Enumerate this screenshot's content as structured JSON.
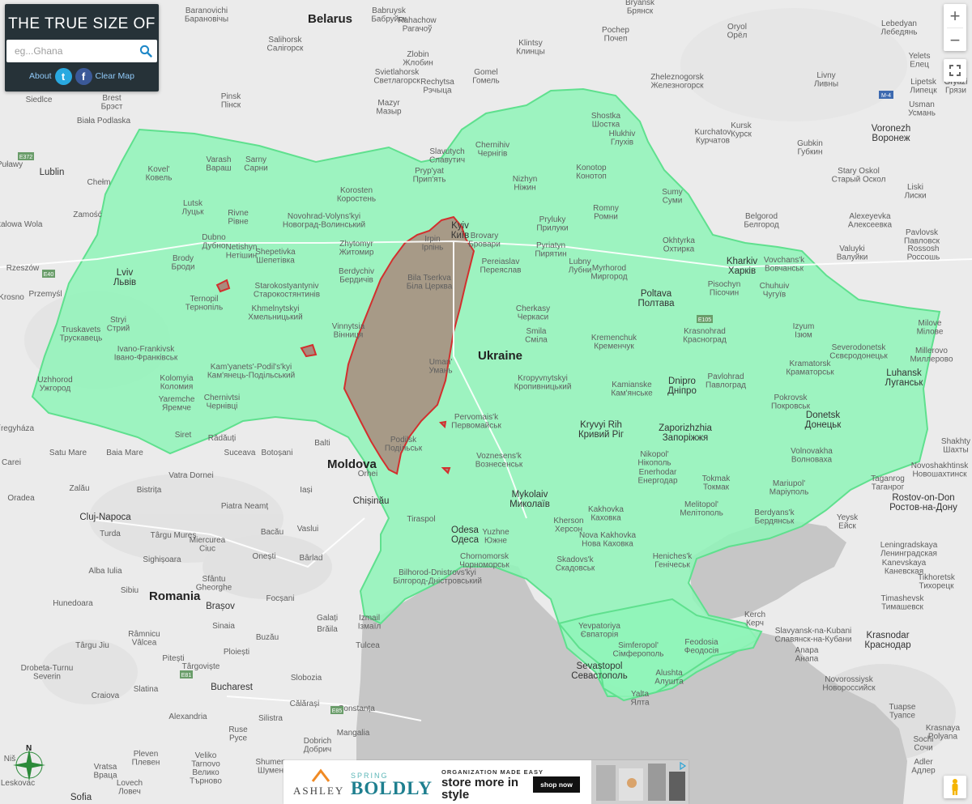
{
  "app": {
    "title": "THE TRUE SIZE OF ...",
    "search_placeholder": "eg...Ghana",
    "about_label": "About",
    "twitter_label": "t",
    "facebook_label": "f",
    "clear_map_label": "Clear Map"
  },
  "controls": {
    "zoom_in": "+",
    "zoom_out": "−"
  },
  "compass": {
    "north_label": "N"
  },
  "map": {
    "countries": {
      "belarus": "Belarus",
      "ukraine": "Ukraine",
      "moldova": "Moldova",
      "romania": "Romania"
    },
    "places": {
      "baranovichi": "Baranovichi\nБарановічы",
      "babruysk": "Babruysk\nБабруйск",
      "salihorsk": "Salihorsk\nСалігорск",
      "rachu": "Rahachow\nРагачоў",
      "pochep": "Pochep\nПочеп",
      "bryansk": "Bryansk\nБрянск",
      "oryol": "Oryol\nОрёл",
      "lebedyan": "Lebedyan\nЛебедянь",
      "yelets": "Yelets\nЕлец",
      "zlobin": "Zlobin\nЖлобин",
      "klintsy": "Klintsy\nКлинцы",
      "gomel": "Gomel\nГомель",
      "svietlahorsk": "Svietlahorsk\nСветлагорск",
      "rechytsa": "Rechytsa\nРэчыца",
      "livny": "Livny\nЛивны",
      "lipetsk": "Lipetsk\nЛипецк",
      "zheleznogorsk": "Zheleznogorsk\nЖелезногорск",
      "gryazi": "Gryazi\nГрязи",
      "pinsk": "Pinsk\nПінск",
      "mazyr": "Mazyr\nМазыр",
      "brest": "Brest\nБрэст",
      "siedlce": "Siedlce",
      "biala": "Biała Podlaska",
      "shostka": "Shostka\nШостка",
      "chernihiv": "Chernihiv\nЧернігів",
      "hlukhiv": "Hlukhiv\nГлухів",
      "kursk": "Kursk\nКурск",
      "kurchatov": "Kurchatov\nКурчатов",
      "usman": "Usman\nУсмань",
      "voronezh": "Voronezh\nВоронеж",
      "lublin": "Lublin",
      "chelm": "Chełm",
      "pulawy": "Puławy",
      "kovel": "Kovel'\nКовель",
      "varash": "Varash\nВараш",
      "sarny": "Sarny\nСарни",
      "slavutych": "Slavutych\nСлавутич",
      "prypyat": "Pryp'yat\nПрип'ять",
      "korosten": "Korosten\nКоростень",
      "nizhyn": "Nizhyn\nНіжин",
      "konotop": "Konotop\nКонотоп",
      "gubkin": "Gubkin\nГубкин",
      "stary_oskol": "Stary Oskol\nСтарый Оскол",
      "liski": "Liski\nЛиски",
      "sumy": "Sumy\nСуми",
      "romny": "Romny\nРомни",
      "lutsk": "Lutsk\nЛуцьк",
      "zamosc": "Zamość",
      "rivne": "Rivne\nРівне",
      "novohrad": "Novohrad-Volyns'kyi\nНовоград-Волинський",
      "kyiv": "Kyiv\nКиїв",
      "irpin": "Irpin\nІрпінь",
      "brovary": "Brovary\nБровари",
      "pryluky": "Pryluky\nПрилуки",
      "belgorod": "Belgorod\nБелгород",
      "alexeyevka": "Alexeyevka\nАлексеевка",
      "stalowa": "Stalowa Wola",
      "dubno": "Dubno\nДубно",
      "netishyn": "Netishyn\nНетішин",
      "shepetivka": "Shepetivka\nШепетівка",
      "zhytomyr": "Zhytomyr\nЖитомир",
      "pyriatyn": "Pyriatyn\nПирятин",
      "okhtyrka": "Okhtyrka\nОхтирка",
      "pavlovsk": "Pavlovsk\nПавловск",
      "rzeszow": "Rzeszów",
      "brody": "Brody\nБроди",
      "berdychiv": "Berdychiv\nБердичів",
      "pereiaslav": "Pereiaslav\nПереяслав",
      "lubny": "Lubny\nЛубни",
      "myrhorod": "Myrhorod\nМиргород",
      "kharkiv": "Kharkiv\nХарків",
      "vovchansk": "Vovchans'k\nВовчанськ",
      "valuyki": "Valuyki\nВалуйки",
      "rossosh": "Rossosh\nРоссошь",
      "krosno": "Krosno",
      "przemysl": "Przemyśl",
      "lviv": "Lviv\nЛьвів",
      "starokostiantyniv": "Starokostyantyniv\nСтарокостянтинів",
      "bila_tserkva": "Bila Tserkva\nБіла Церква",
      "poltava": "Poltava\nПолтава",
      "pisochyn": "Pisochyn\nПісочин",
      "chuhuiv": "Chuhuiv\nЧугуїв",
      "ternopil": "Ternopil\nТернопіль",
      "khmelnytskyi": "Khmelnytskyi\nХмельницький",
      "cherkasy": "Cherkasy\nЧеркаси",
      "stryi": "Stryi\nСтрий",
      "truskavets": "Truskavets\nТрускавець",
      "vinnytsia": "Vinnytsia\nВінниця",
      "smila": "Smila\nСміла",
      "kremenchuk": "Kremenchuk\nКременчук",
      "krasnohrad": "Krasnohrad\nКрасноград",
      "izyum": "Izyum\nІзюм",
      "millerovo": "Millerovo\nМиллерово",
      "milove": "Milove\nМілове",
      "ivano": "Ivano-Frankivsk\nІвано-Франківськ",
      "uman": "Uman'\nУмань",
      "severodonetsk": "Severodonetsk\nСєвєродонецьк",
      "kramatorsk": "Kramatorsk\nКраматорськ",
      "uzhhorod": "Uzhhorod\nУжгород",
      "kamianets": "Kam'yanets'-Podil's'kyi\nКам'янець-Подільський",
      "kolomyia": "Kolomyia\nКоломия",
      "kropyvnytskyi": "Kropyvnytskyi\nКропивницький",
      "dnipro": "Dnipro\nДніпро",
      "kamianske": "Kamianske\nКам'янське",
      "pavlohrad": "Pavlohrad\nПавлоград",
      "luhansk": "Luhansk\nЛуганськ",
      "yaremche": "Yaremche\nЯремче",
      "chernivtsi": "Chernivtsi\nЧернівці",
      "pervomaisk": "Pervomais'k\nПервомайськ",
      "pokrovsk": "Pokrovsk\nПокровськ",
      "donetsk": "Donetsk\nДонецьк",
      "nyiregyhaza": "Nyíregyháza",
      "siret": "Siret",
      "radauti": "Rădăuți",
      "balti": "Balti",
      "podilsk": "Podilsk\nПодільськ",
      "kryvyi": "Kryvyi Rih\nКривий Ріг",
      "zaporizhzhia": "Zaporizhzhia\nЗапоріжжя",
      "shakhty": "Shakhty\nШахты",
      "satu_mare": "Satu Mare",
      "baia_mare": "Baia Mare",
      "suceava": "Suceava",
      "botosani": "Botoșani",
      "orhei": "Orhei",
      "voznesensk": "Voznesens'k\nВознесенськ",
      "nikopol": "Nikopol'\nНікополь",
      "enerhodar": "Enerhodar\nЕнергодар",
      "volnovakha": "Volnovakha\nВолноваха",
      "novoshakhtinsk": "Novoshakhtinsk\nНовошахтинск",
      "carei": "Carei",
      "vatra_dornei": "Vatra Dornei",
      "tokmak": "Tokmak\nТокмак",
      "mariupol": "Mariupol'\nМаріуполь",
      "taganrog": "Taganrog\nТаганрог",
      "rostov": "Rostov-on-Don\nРостов-на-Дону",
      "oradea": "Oradea",
      "zalau": "Zalău",
      "bistrita": "Bistrița",
      "iasi": "Iași",
      "chisinau": "Chișinău",
      "mykolaiv": "Mykolaiv\nМиколаїв",
      "melitopol": "Melitopol'\nМелітополь",
      "berdyansk": "Berdyans'k\nБердянськ",
      "piatra": "Piatra Neamț",
      "tiraspol": "Tiraspol",
      "kherson": "Kherson\nХерсон",
      "kakhovka": "Kakhovka\nКаховка",
      "yeysk": "Yeysk\nЕйск",
      "cluj": "Cluj-Napoca",
      "targu_mures": "Târgu Mureș",
      "bacau": "Bacău",
      "vaslui": "Vaslui",
      "odesa": "Odesa\nОдеса",
      "yuzhne": "Yuzhne\nЮжне",
      "nova_kakhovka": "Nova Kakhovka\nНова Каховка",
      "turda": "Turda",
      "miercurea": "Miercurea\nCiuc",
      "chornomorsk": "Chornomorsk\nЧорноморськ",
      "leningradskaya": "Leningradskaya\nЛенинградская",
      "sighisoara": "Sighișoara",
      "onesti": "Onești",
      "barlad": "Bârlad",
      "skadovsk": "Skadovs'k\nСкадовськ",
      "heniches": "Heniches'k\nГенічеськ",
      "kanevskaya": "Kanevskaya\nКаневская",
      "alba_iulia": "Alba Iulia",
      "bilhorod": "Bilhorod-Dnistrovs'kyi\nБілгород-Дністровський",
      "sibiu": "Sibiu",
      "sfantu": "Sfântu\nGheorghe",
      "tikhoretsk": "Tikhoretsk\nТихорецк",
      "timashevsk": "Timashevsk\nТимашевск",
      "hunedoara": "Hunedoara",
      "brasov": "Brașov",
      "focsani": "Focșani",
      "galati": "Galați",
      "kerch": "Kerch\nКерч",
      "izmail": "Izmail\nІзмаїл",
      "yevpatoriya": "Yevpatoriya\nЄвпаторія",
      "slavyansk": "Slavyansk-na-Kubani\nСлавянск-на-Кубани",
      "krasnodar": "Krasnodar\nКраснодар",
      "ramnicu": "Râmnicu\nVâlcea",
      "sinaia": "Sinaia",
      "braila": "Brăila",
      "targu_jiu": "Târgu Jiu",
      "buzau": "Buzău",
      "simferopol": "Simferopol'\nСімферополь",
      "feodosia": "Feodosia\nФеодосія",
      "anapa": "Anapa\nАнапа",
      "pitesti": "Pitești",
      "ploiesti": "Ploiești",
      "tulcea": "Tulcea",
      "drobeta": "Drobeta-Turnu\nSeverin",
      "targoviste": "Târgoviște",
      "sevastopol": "Sevastopol\nСевастополь",
      "alushta": "Alushta\nАлушта",
      "novorossiysk": "Novorossiysk\nНовороссийск",
      "slobozia": "Slobozia",
      "craiova": "Craiova",
      "bucharest": "Bucharest",
      "yalta": "Yalta\nЯлта",
      "slatina": "Slatina",
      "calarasi": "Călărași",
      "constanta": "Constanța",
      "tuapse": "Tuapse\nТуапсе",
      "alexandria": "Alexandria",
      "silistra": "Silistra",
      "ruse": "Ruse\nРусе",
      "mangalia": "Mangalia",
      "pleven": "Pleven\nПлевен",
      "dobrich": "Dobrich\nДобрич",
      "sochi": "Sochi\nСочи",
      "krasnaya": "Krasnaya\nPolyana",
      "veliko": "Veliko\nTarnovo\nВелико\nТърново",
      "shumen": "Shumen\nШумен",
      "vratsa": "Vratsa\nВраца",
      "adler": "Adler\nАдлер",
      "lovech": "Lovech\nЛовеч",
      "sofia": "Sofia",
      "nis": "Niš",
      "leskovac": "Leskovac"
    },
    "road_shields": [
      "E372",
      "E40",
      "E105",
      "M-4",
      "E81",
      "E85"
    ]
  },
  "ad": {
    "brand": "ASHLEY",
    "spring": "SPRING",
    "boldly": "BOLDLY",
    "tagline": "ORGANIZATION MADE EASY",
    "headline": "store more in style",
    "cta": "shop now"
  },
  "colors": {
    "panel_bg": "#263238",
    "ukraine_fill": "#8ff5b8",
    "ukraine_stroke": "#5fe08e",
    "overlay_fill": "#a98a7c",
    "overlay_stroke": "#d2302e",
    "sea": "#c6c6c6"
  }
}
